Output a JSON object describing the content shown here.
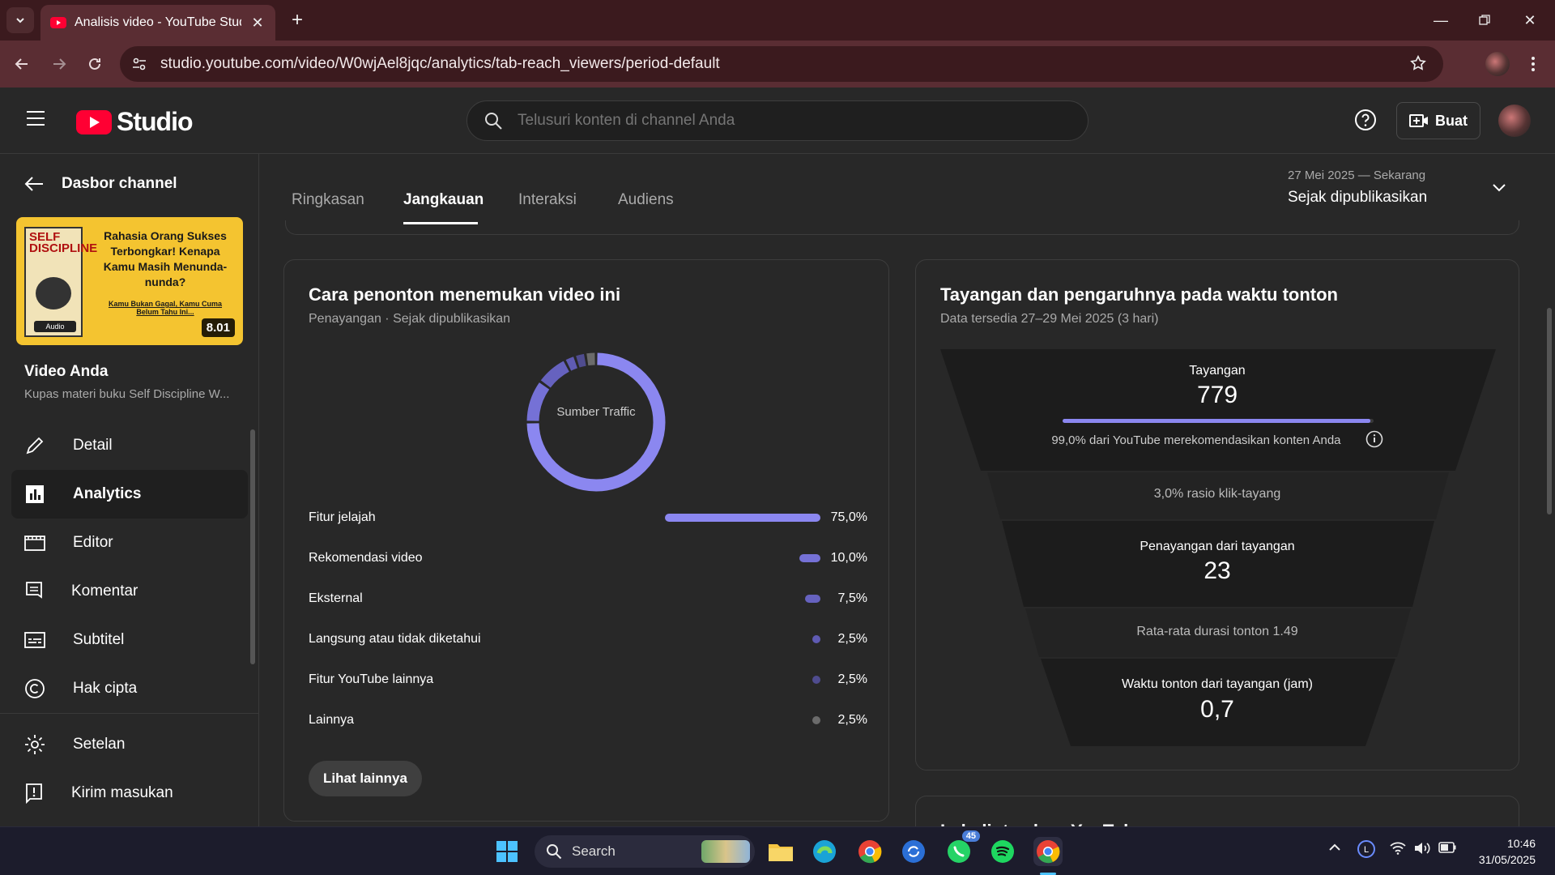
{
  "browser": {
    "tab_title": "Analisis video - YouTube Studio",
    "url": "studio.youtube.com/video/W0wjAel8jqc/analytics/tab-reach_viewers/period-default"
  },
  "header": {
    "logo_text": "Studio",
    "search_placeholder": "Telusuri konten di channel Anda",
    "create_label": "Buat"
  },
  "sidebar": {
    "back_label": "Dasbor channel",
    "thumbnail": {
      "book_title": "SELF DISCIPLINE",
      "book_badge": "Audio",
      "text": "Rahasia Orang Sukses Terbongkar! Kenapa Kamu Masih Menunda-nunda?",
      "sub": "Kamu Bukan Gagal, Kamu Cuma Belum Tahu Ini...",
      "duration": "8.01"
    },
    "video_title": "Video Anda",
    "video_sub": "Kupas materi buku Self Discipline W...",
    "items": [
      {
        "label": "Detail",
        "icon": "pencil-icon"
      },
      {
        "label": "Analytics",
        "icon": "analytics-icon"
      },
      {
        "label": "Editor",
        "icon": "film-icon"
      },
      {
        "label": "Komentar",
        "icon": "comment-icon"
      },
      {
        "label": "Subtitel",
        "icon": "subtitles-icon"
      },
      {
        "label": "Hak cipta",
        "icon": "copyright-icon"
      }
    ],
    "footer_items": [
      {
        "label": "Setelan",
        "icon": "gear-icon"
      },
      {
        "label": "Kirim masukan",
        "icon": "feedback-icon"
      }
    ]
  },
  "tabs": [
    "Ringkasan",
    "Jangkauan",
    "Interaksi",
    "Audiens"
  ],
  "period": {
    "range": "27 Mei 2025 — Sekarang",
    "label": "Sejak dipublikasikan"
  },
  "traffic_card": {
    "title": "Cara penonton menemukan video ini",
    "subtitle": "Penayangan · Sejak dipublikasikan",
    "donut_label": "Sumber Traffic",
    "more_label": "Lihat lainnya"
  },
  "chart_data": {
    "type": "pie",
    "title": "Sumber Traffic",
    "categories": [
      "Fitur jelajah",
      "Rekomendasi video",
      "Eksternal",
      "Langsung atau tidak diketahui",
      "Fitur YouTube lainnya",
      "Lainnya"
    ],
    "values": [
      75.0,
      10.0,
      7.5,
      2.5,
      2.5,
      2.5
    ],
    "labels": [
      "75,0%",
      "10,0%",
      "7,5%",
      "2,5%",
      "2,5%",
      "2,5%"
    ],
    "colors": [
      "#8b87f0",
      "#7571d6",
      "#6662bf",
      "#5f5bb3",
      "#4f4c8f",
      "#6b6b6b"
    ]
  },
  "funnel_card": {
    "title": "Tayangan dan pengaruhnya pada waktu tonton",
    "subtitle": "Data tersedia 27–29 Mei 2025 (3 hari)",
    "impressions_label": "Tayangan",
    "impressions_value": "779",
    "recommend_text": "99,0% dari YouTube merekomendasikan konten Anda",
    "recommend_fraction": 0.99,
    "ctr_text": "3,0% rasio klik-tayang",
    "views_label": "Penayangan dari tayangan",
    "views_value": "23",
    "avg_duration_text": "Rata-rata durasi tonton 1.49",
    "watch_time_label": "Waktu tonton dari tayangan (jam)",
    "watch_time_value": "0,7"
  },
  "next_card": {
    "title": "Lalu lintas luar YouTube"
  },
  "taskbar": {
    "search_label": "Search",
    "whatsapp_badge": "45",
    "time": "10:46",
    "date": "31/05/2025"
  }
}
